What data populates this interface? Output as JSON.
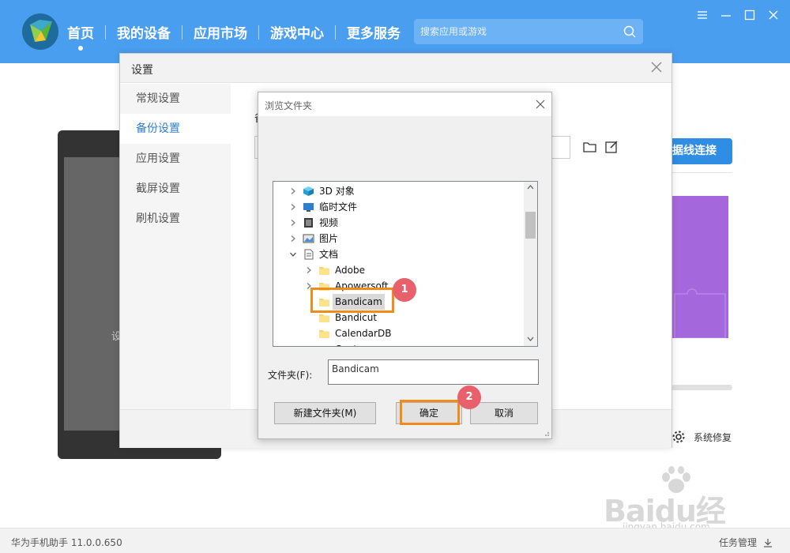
{
  "app": {
    "nav": [
      "首页",
      "我的设备",
      "应用市场",
      "游戏中心",
      "更多服务"
    ],
    "active_nav": 0,
    "search_placeholder": "搜索应用或游戏",
    "version": "华为手机助手 11.0.0.650",
    "task_manager": "任务管理",
    "brand_color": "#4a9ef0"
  },
  "background": {
    "phone_text": "设",
    "connect_button": "据线连接",
    "system_repair": "系统修复",
    "watermark_text": "Baidu经验",
    "watermark_url": "jingyan.baidu.com"
  },
  "settings": {
    "title": "设置",
    "menu": [
      "常规设置",
      "备份设置",
      "应用设置",
      "截屏设置",
      "刷机设置"
    ],
    "active_menu": 1,
    "backup_label": "备"
  },
  "browse_dialog": {
    "title": "浏览文件夹",
    "tree": [
      {
        "label": "3D 对象",
        "icon": "3d-objects-icon",
        "level": 1,
        "expander": "collapsed"
      },
      {
        "label": "临时文件",
        "icon": "desktop-folder-icon",
        "level": 1,
        "expander": "collapsed"
      },
      {
        "label": "视频",
        "icon": "video-folder-icon",
        "level": 1,
        "expander": "collapsed"
      },
      {
        "label": "图片",
        "icon": "pictures-folder-icon",
        "level": 1,
        "expander": "collapsed"
      },
      {
        "label": "文档",
        "icon": "documents-folder-icon",
        "level": 1,
        "expander": "expanded"
      },
      {
        "label": "Adobe",
        "icon": "folder-icon",
        "level": 2,
        "expander": "collapsed"
      },
      {
        "label": "Apowersoft",
        "icon": "folder-icon",
        "level": 2,
        "expander": "collapsed"
      },
      {
        "label": "Bandicam",
        "icon": "folder-icon",
        "level": 2,
        "expander": "none",
        "selected": true
      },
      {
        "label": "Bandicut",
        "icon": "folder-icon",
        "level": 2,
        "expander": "none"
      },
      {
        "label": "CalendarDB",
        "icon": "folder-icon",
        "level": 2,
        "expander": "none"
      },
      {
        "label": "Cont...",
        "icon": "folder-icon",
        "level": 2,
        "expander": "collapsed"
      }
    ],
    "folder_label": "文件夹(F):",
    "folder_value": "Bandicam",
    "new_folder_button": "新建文件夹(M)",
    "ok_button": "确定",
    "cancel_button": "取消",
    "annotations": [
      "1",
      "2"
    ],
    "highlight_color": "#f08c1c",
    "badge_color": "#e8606b"
  }
}
